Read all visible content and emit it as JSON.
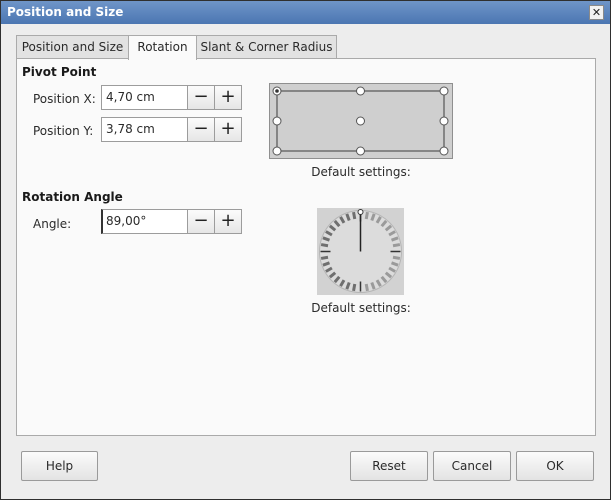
{
  "window": {
    "title": "Position and Size",
    "close_glyph": "✕"
  },
  "tabs": [
    {
      "label": "Position and Size",
      "active": false
    },
    {
      "label": "Rotation",
      "active": true
    },
    {
      "label": "Slant & Corner Radius",
      "active": false
    }
  ],
  "pivot": {
    "section_title": "Pivot Point",
    "position_x_label": "Position X:",
    "position_x_value": "4,70 cm",
    "position_y_label": "Position Y:",
    "position_y_value": "3,78 cm",
    "default_caption": "Default settings:"
  },
  "rotation": {
    "section_title": "Rotation Angle",
    "angle_label": "Angle:",
    "angle_value": "89,00°",
    "default_caption": "Default settings:"
  },
  "spin": {
    "minus": "−",
    "plus": "+"
  },
  "buttons": {
    "help": "Help",
    "reset": "Reset",
    "cancel": "Cancel",
    "ok": "OK"
  }
}
